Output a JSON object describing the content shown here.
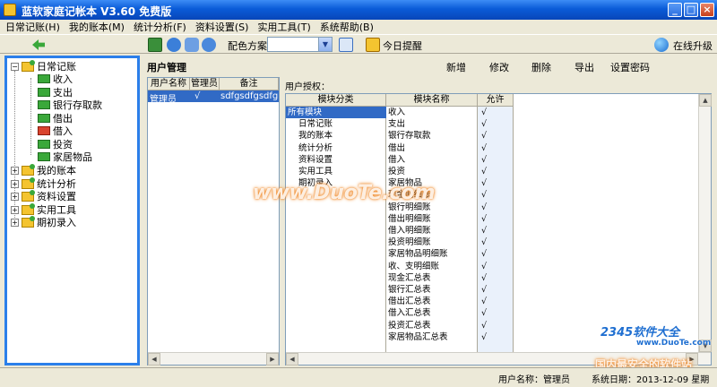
{
  "window": {
    "title": "蓝软家庭记帐本 V3.60  免费版",
    "min": "_",
    "max": "□",
    "close": "×"
  },
  "menu": [
    "日常记账(H)",
    "我的账本(M)",
    "统计分析(F)",
    "资料设置(S)",
    "实用工具(T)",
    "系统帮助(B)"
  ],
  "toolbar": {
    "scheme_label": "配色方案",
    "scheme_value": "",
    "today_label": "今日提醒",
    "upgrade_label": "在线升级"
  },
  "tree": {
    "root": "日常记账",
    "children": [
      "收入",
      "支出",
      "银行存取款",
      "借出",
      "借入",
      "投资",
      "家居物品"
    ],
    "groups": [
      "我的账本",
      "统计分析",
      "资料设置",
      "实用工具",
      "期初录入"
    ]
  },
  "main": {
    "title": "用户管理",
    "actions": [
      "新增",
      "修改",
      "删除",
      "导出",
      "设置密码"
    ],
    "user_table": {
      "headers": [
        "用户名称",
        "管理员",
        "备注"
      ],
      "rows": [
        [
          "管理员",
          "√",
          "sdfgsdfgsdfg"
        ]
      ]
    },
    "perm_label": "用户授权：",
    "perm_headers": [
      "模块分类",
      "模块名称",
      "允许"
    ],
    "categories": [
      "所有模块",
      "日常记账",
      "我的账本",
      "统计分析",
      "资料设置",
      "实用工具",
      "期初录入"
    ],
    "modules": [
      "收入",
      "支出",
      "银行存取款",
      "借出",
      "借入",
      "投资",
      "家居物品",
      "现金明细账",
      "银行明细账",
      "借出明细账",
      "借入明细账",
      "投资明细账",
      "家居物品明细账",
      "收、支明细账",
      "现金汇总表",
      "银行汇总表",
      "借出汇总表",
      "借入汇总表",
      "投资汇总表",
      "家居物品汇总表"
    ],
    "allow_mark": "√"
  },
  "status": {
    "user": "用户名称：管理员",
    "date": "系统日期：2013-12-09  星期一"
  },
  "watermarks": {
    "duote": "www.DuoTe.com",
    "brand": "2345软件大全",
    "brand_url": "www.DuoTe.com",
    "slogan": "国内最安全的软件站"
  },
  "colors": {
    "titlebar": "#0a5bd8",
    "selection": "#316ac5",
    "panel_border": "#2b7fea"
  }
}
